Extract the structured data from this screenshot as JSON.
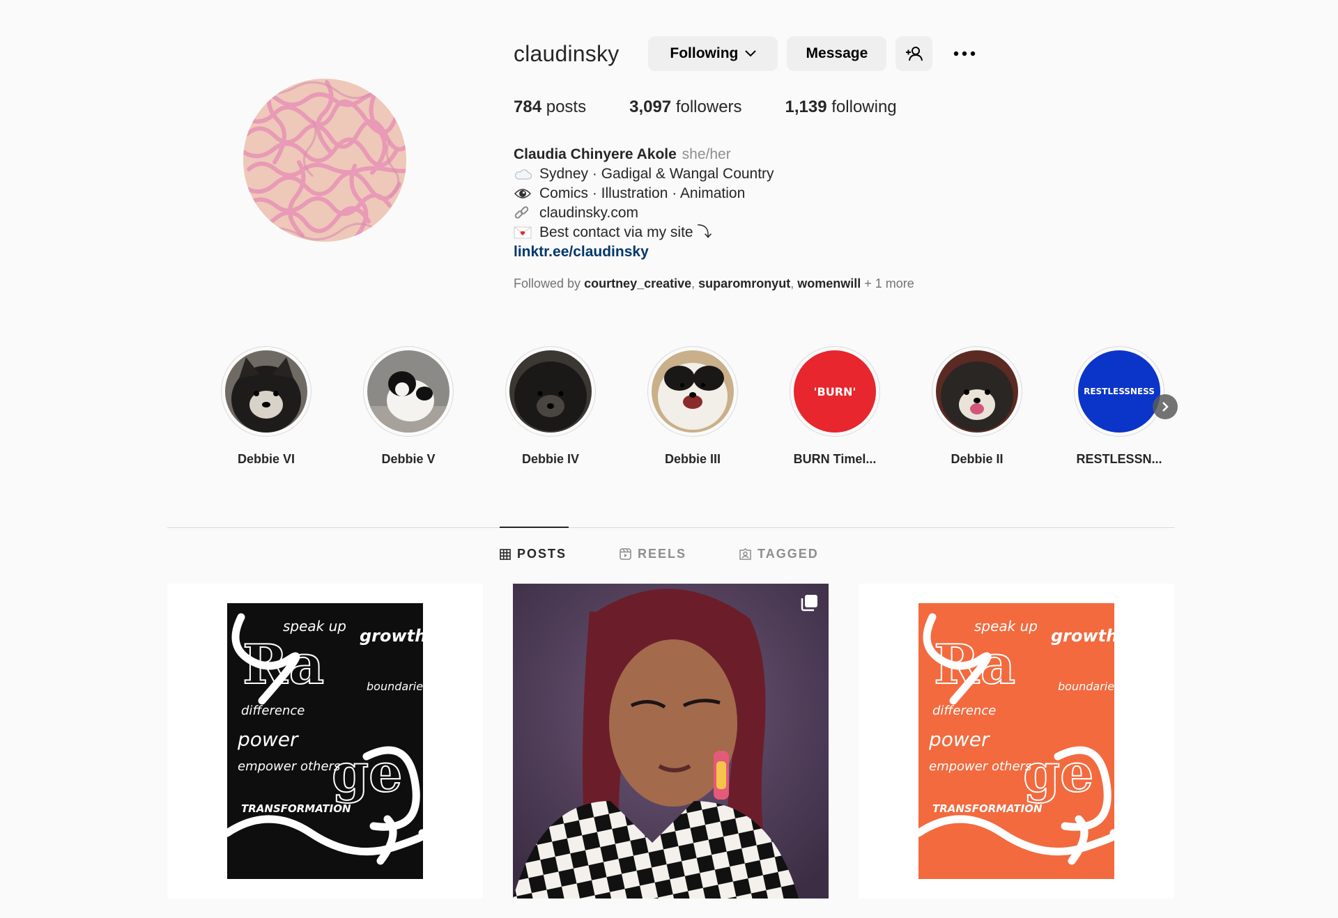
{
  "profile": {
    "username": "claudinsky",
    "following_button": "Following",
    "message_button": "Message",
    "stats": {
      "posts_count": "784",
      "posts_label": "posts",
      "followers_count": "3,097",
      "followers_label": "followers",
      "following_count": "1,139",
      "following_label": "following"
    },
    "bio": {
      "name": "Claudia Chinyere Akole",
      "pronouns": "she/her",
      "lines": [
        {
          "icon": "cloud-icon",
          "text": "Sydney · Gadigal & Wangal Country"
        },
        {
          "icon": "eye-icon",
          "text": "Comics · Illustration · Animation"
        },
        {
          "icon": "link-icon",
          "text": "claudinsky.com"
        },
        {
          "icon": "love-letter-icon",
          "text": "Best contact via my site ⤵"
        }
      ],
      "link": "linktr.ee/claudinsky"
    },
    "followed_by": {
      "prefix": "Followed by",
      "users": [
        "courtney_creative",
        "suparomronyut",
        "womenwill"
      ],
      "more": "+ 1 more"
    }
  },
  "highlights": [
    {
      "label": "Debbie VI",
      "icon": "dog-photo"
    },
    {
      "label": "Debbie V",
      "icon": "dog-photo"
    },
    {
      "label": "Debbie IV",
      "icon": "dog-photo"
    },
    {
      "label": "Debbie III",
      "icon": "dog-photo"
    },
    {
      "label": "BURN Timel...",
      "icon": "burn-poster",
      "cover_text": "'BURN'"
    },
    {
      "label": "Debbie II",
      "icon": "dog-photo"
    },
    {
      "label": "RESTLESSN...",
      "icon": "restlessness-poster",
      "cover_text": "RESTLESSNESS"
    }
  ],
  "tabs": [
    {
      "label": "POSTS",
      "icon": "grid-icon",
      "active": true
    },
    {
      "label": "REELS",
      "icon": "reels-icon",
      "active": false
    },
    {
      "label": "TAGGED",
      "icon": "tagged-icon",
      "active": false
    }
  ],
  "posts": [
    {
      "type": "poster",
      "color": "#000000",
      "words": [
        "speak up",
        "growth",
        "Rage",
        "difference",
        "power",
        "empower others",
        "boundaries",
        "TRANSFORMATION"
      ]
    },
    {
      "type": "portrait",
      "multi": true
    },
    {
      "type": "poster",
      "color": "#f26a3e",
      "words": [
        "speak up",
        "growth",
        "Rage",
        "difference",
        "power",
        "empower others",
        "boundaries",
        "TRANSFORMATION"
      ]
    }
  ],
  "colors": {
    "link": "#00376b",
    "burn_red": "#e8262d",
    "restless_blue": "#0b34c9",
    "poster_orange": "#f26a3e"
  }
}
